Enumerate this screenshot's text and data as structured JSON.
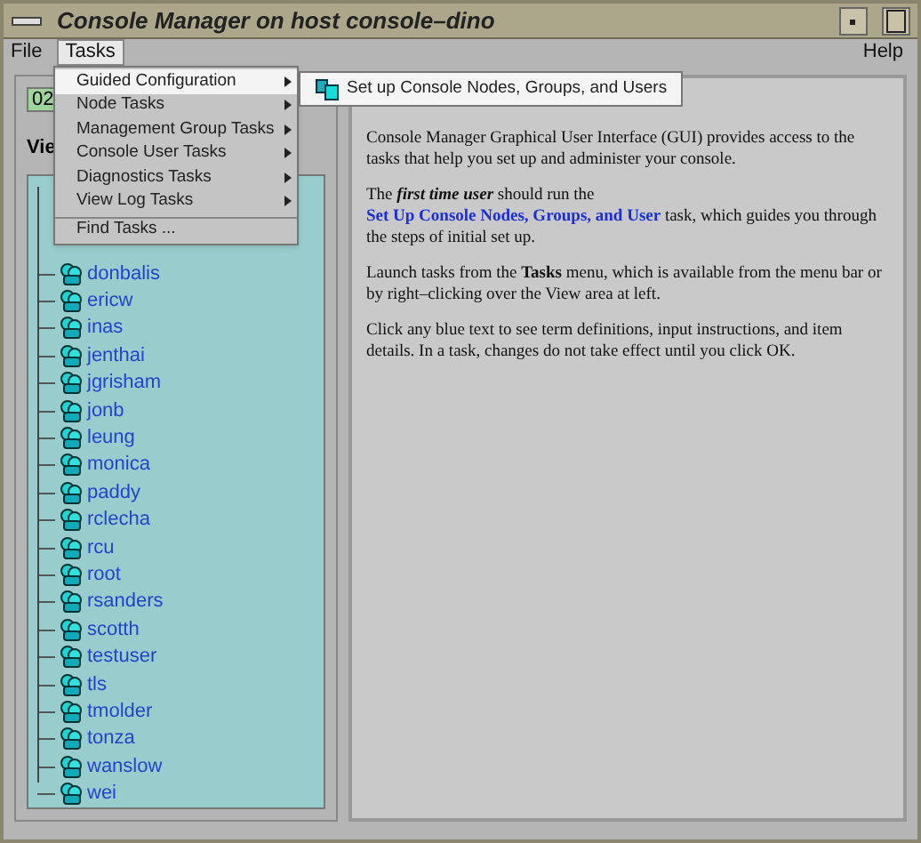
{
  "window": {
    "title": "Console Manager on host console–dino"
  },
  "menubar": [
    {
      "label": "File",
      "selected": false
    },
    {
      "label": "Tasks",
      "selected": true
    }
  ],
  "help_menu": {
    "label": "Help"
  },
  "left_panel": {
    "field_value": "02",
    "view_label": "Vie",
    "tree_items": [
      "donbalis",
      "ericw",
      "inas",
      "jenthai",
      "jgrisham",
      "jonb",
      "leung",
      "monica",
      "paddy",
      "rclecha",
      "rcu",
      "root",
      "rsanders",
      "scotth",
      "testuser",
      "tls",
      "tmolder",
      "tonza",
      "wanslow",
      "wei"
    ]
  },
  "tasks_menu": [
    {
      "label": "Guided Configuration",
      "submenu": true,
      "selected": true
    },
    {
      "label": "Node Tasks",
      "submenu": true,
      "selected": false
    },
    {
      "label": "Management Group Tasks",
      "submenu": true,
      "selected": false
    },
    {
      "label": "Console User Tasks",
      "submenu": true,
      "selected": false
    },
    {
      "label": "Diagnostics Tasks",
      "submenu": true,
      "selected": false
    },
    {
      "label": "View Log Tasks",
      "submenu": true,
      "selected": false
    },
    {
      "label": "Find Tasks ...",
      "submenu": false,
      "selected": false
    }
  ],
  "submenu": [
    {
      "label": "Set up Console Nodes, Groups, and Users"
    }
  ],
  "content": {
    "paragraphs": [
      [
        {
          "kind": "plain",
          "text": "Console Manager Graphical User Interface (GUI) provides access to the tasks that help you set up and administer your console."
        }
      ],
      [
        {
          "kind": "plain",
          "text": "The "
        },
        {
          "kind": "emphasis",
          "text": "first time user"
        },
        {
          "kind": "plain",
          "text": " should run the "
        },
        {
          "kind": "link",
          "text": "Set Up Console Nodes, Groups, and User"
        },
        {
          "kind": "plain",
          "text": " task, which guides you through the steps of initial set up."
        }
      ],
      [
        {
          "kind": "plain",
          "text": "Launch tasks from the "
        },
        {
          "kind": "bold",
          "text": "Tasks"
        },
        {
          "kind": "plain",
          "text": " menu, which is available from the menu bar or by right–clicking over the View area at left."
        }
      ],
      [
        {
          "kind": "plain",
          "text": "Click any blue text to see term definitions, input instructions, and item details. In a task, changes do not take effect until you click OK."
        }
      ]
    ]
  }
}
